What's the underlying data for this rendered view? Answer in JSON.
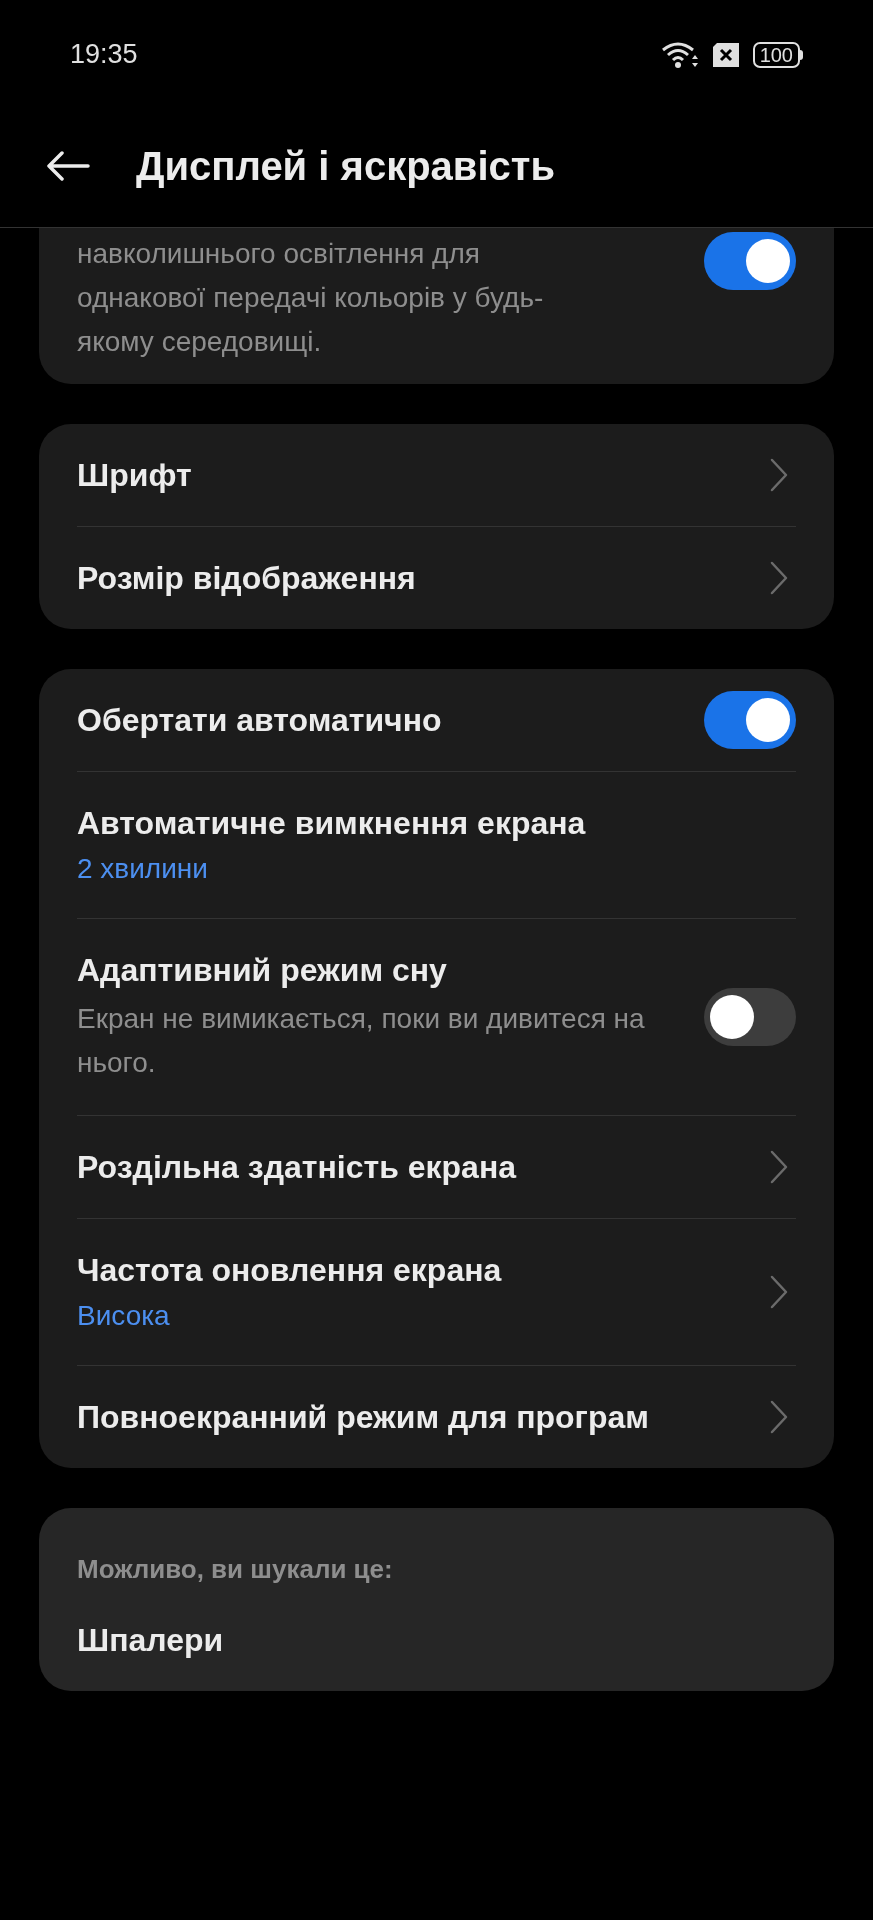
{
  "status_bar": {
    "time": "19:35",
    "battery": "100"
  },
  "header": {
    "title": "Дисплей і яскравість"
  },
  "sections": [
    {
      "items": [
        {
          "kind": "toggle",
          "description": "навколишнього освітлення для однакової передачі кольорів у будь-якому середовищі.",
          "on": true
        }
      ]
    },
    {
      "items": [
        {
          "kind": "link",
          "title": "Шрифт"
        },
        {
          "kind": "link",
          "title": "Розмір відображення"
        }
      ]
    },
    {
      "items": [
        {
          "kind": "toggle",
          "title": "Обертати автоматично",
          "on": true
        },
        {
          "kind": "plain",
          "title": "Автоматичне вимкнення екрана",
          "value": "2 хвилини"
        },
        {
          "kind": "toggle",
          "title": "Адаптивний режим сну",
          "description": "Екран не вимикається, поки ви дивитеся на нього.",
          "on": false
        },
        {
          "kind": "link",
          "title": "Роздільна здатність екрана"
        },
        {
          "kind": "link",
          "title": "Частота оновлення екрана",
          "value": "Висока"
        },
        {
          "kind": "link",
          "title": "Повноекранний режим для програм"
        }
      ]
    },
    {
      "heading": "Можливо, ви шукали це:",
      "items": [
        {
          "kind": "plain",
          "title": "Шпалери"
        }
      ]
    }
  ]
}
